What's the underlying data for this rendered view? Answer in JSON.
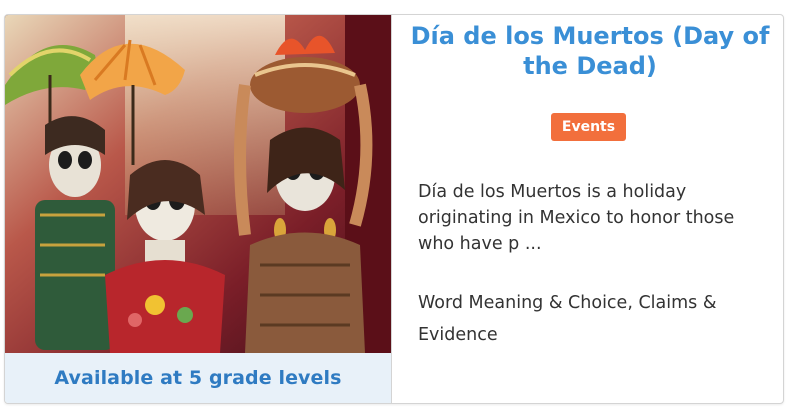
{
  "card": {
    "title": "Día de los Muertos (Day of the Dead)",
    "badge": "Events",
    "description": "Día de los Muertos is a holiday originating in Mexico to honor those who have p ...",
    "skills": "Word Meaning & Choice, Claims & Evidence",
    "grade_levels": "Available at 5 grade levels",
    "image_subject": "Day of the Dead skeleton figurines (catrinas) with umbrellas and a bowl"
  },
  "colors": {
    "title": "#3a8fd6",
    "badge_bg": "#f26f3c",
    "grade_bar_bg": "#e8f1f9",
    "grade_text": "#2f7bc2"
  }
}
